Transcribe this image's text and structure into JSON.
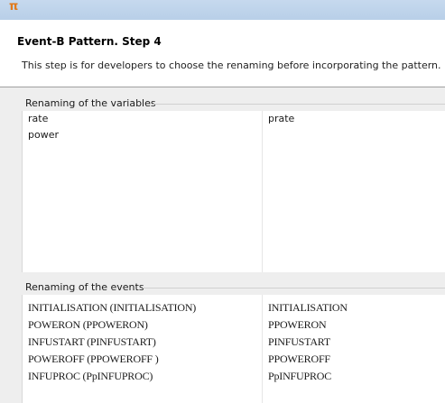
{
  "window": {
    "app_icon": "pattern-app-icon"
  },
  "header": {
    "title": "Event-B Pattern. Step 4",
    "description": "This step is for developers to choose the renaming before incorporating the pattern."
  },
  "variables_group": {
    "label": "Renaming of the variables",
    "rows": [
      {
        "original": "rate",
        "renamed": "prate"
      },
      {
        "original": "power",
        "renamed": ""
      }
    ]
  },
  "events_group": {
    "label": "Renaming of the events",
    "rows": [
      {
        "original": "INITIALISATION (INITIALISATION)",
        "renamed": "INITIALISATION"
      },
      {
        "original": "POWERON (PPOWERON)",
        "renamed": "PPOWERON"
      },
      {
        "original": "INFUSTART (PINFUSTART)",
        "renamed": "PINFUSTART"
      },
      {
        "original": "POWEROFF  (PPOWEROFF )",
        "renamed": "PPOWEROFF"
      },
      {
        "original": "INFUPROC (PpINFUPROC)",
        "renamed": "PpINFUPROC"
      }
    ]
  },
  "colors": {
    "titlebar": "#c6d9ee",
    "body_background": "#eeeeee",
    "app_icon": "#e07a1c"
  }
}
